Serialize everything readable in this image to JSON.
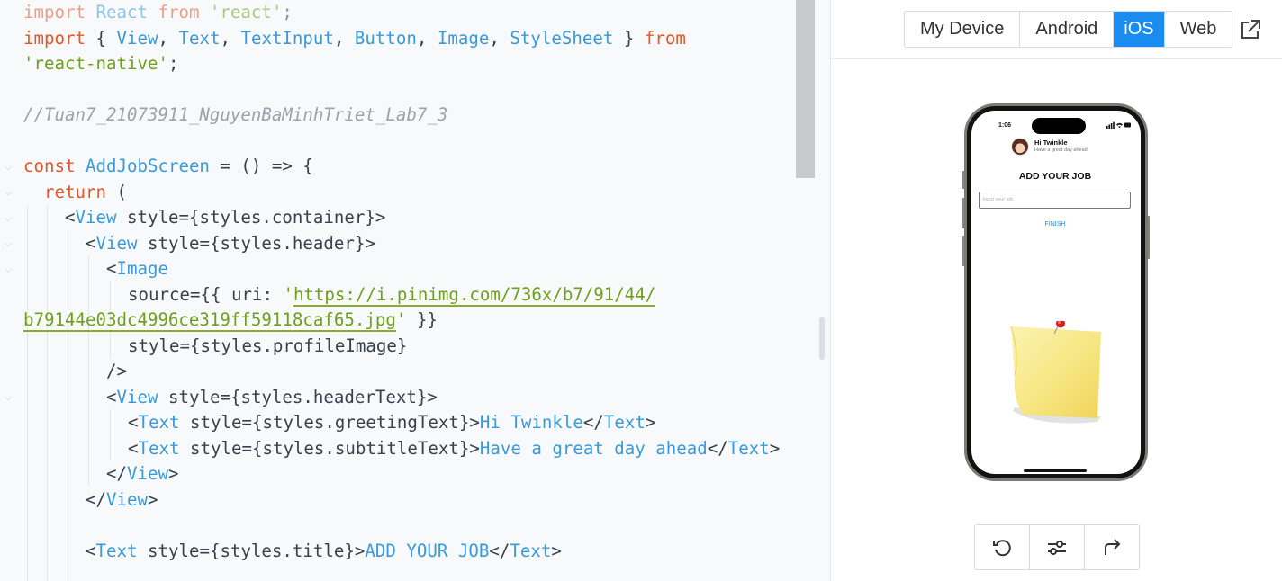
{
  "code": {
    "line1": {
      "kw1": "import",
      "rest": " React ",
      "kw2": "from",
      "str": " 'react'",
      "end": ";"
    },
    "line2": {
      "kw1": "import",
      "p1": " { ",
      "ids": [
        "View",
        "Text",
        "TextInput",
        "Button",
        "Image",
        "StyleSheet"
      ],
      "p2": " } ",
      "kw2": "from"
    },
    "line3": {
      "str": "'react-native'",
      "end": ";"
    },
    "line5": {
      "comment": "//Tuan7_21073911_NguyenBaMinhTriet_Lab7_3"
    },
    "line7": {
      "kw": "const",
      "name": "AddJobScreen",
      "rest": " = () => {"
    },
    "line8": {
      "kw": "return",
      "rest": " ("
    },
    "line9": {
      "open": "<",
      "tag": "View",
      "attr": " style={styles.container}>"
    },
    "line10": {
      "open": "<",
      "tag": "View",
      "attr": " style={styles.header}>"
    },
    "line11": {
      "open": "<",
      "tag": "Image"
    },
    "line12": {
      "pre": "source={{ uri: ",
      "q": "'",
      "url": "https://i.pinimg.com/736x/b7/91/44/"
    },
    "line13": {
      "url": "b79144e03dc4996ce319ff59118caf65.jpg",
      "q": "'",
      "rest": " }}"
    },
    "line14": {
      "text": "style={styles.profileImage}"
    },
    "line15": {
      "text": "/>"
    },
    "line16": {
      "open": "<",
      "tag": "View",
      "attr": " style={styles.headerText}>"
    },
    "line17": {
      "open": "<",
      "tag": "Text",
      "attr": " style={styles.greetingText}>",
      "content": "Hi Twinkle",
      "close_open": "</",
      "close_tag": "Text",
      "close_end": ">"
    },
    "line18": {
      "open": "<",
      "tag": "Text",
      "attr": " style={styles.subtitleText}>",
      "content": "Have a great day ahead",
      "close_open": "</",
      "close_tag": "Text",
      "close_end": ">"
    },
    "line19": {
      "close_open": "</",
      "close_tag": "View",
      "close_end": ">"
    },
    "line20": {
      "close_open": "</",
      "close_tag": "View",
      "close_end": ">"
    },
    "line22": {
      "open": "<",
      "tag": "Text",
      "attr": " style={styles.title}>",
      "content": "ADD YOUR JOB",
      "close_open": "</",
      "close_tag": "Text",
      "close_end": ">"
    }
  },
  "preview": {
    "tabs": [
      {
        "label": "My Device",
        "active": false
      },
      {
        "label": "Android",
        "active": false
      },
      {
        "label": "iOS",
        "active": true
      },
      {
        "label": "Web",
        "active": false
      }
    ],
    "phone": {
      "time": "1:06",
      "greeting": "Hi Twinkle",
      "subtitle": "Have a great day ahead",
      "title": "ADD YOUR JOB",
      "input_placeholder": "input your job",
      "finish_label": "FINISH"
    },
    "toolbar": [
      "reload-icon",
      "settings-sliders-icon",
      "share-icon"
    ]
  },
  "colors": {
    "accent": "#1a8cf0",
    "keyword": "#e4562b",
    "identifier": "#3a9ad9",
    "string": "#6f9f1f",
    "comment": "#9aa3ab"
  }
}
